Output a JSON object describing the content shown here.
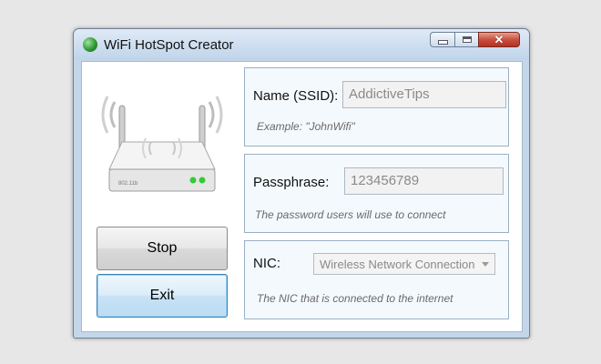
{
  "window": {
    "title": "WiFi HotSpot Creator",
    "controls": {
      "minimize": "minimize",
      "maximize": "maximize",
      "close": "✕"
    }
  },
  "router_image": {
    "label": "802.11b"
  },
  "buttons": {
    "stop": "Stop",
    "exit": "Exit"
  },
  "ssid": {
    "label": "Name (SSID):",
    "value": "AddictiveTips",
    "hint": "Example: \"JohnWifi\""
  },
  "passphrase": {
    "label": "Passphrase:",
    "value": "123456789",
    "hint": "The password users will use to connect"
  },
  "nic": {
    "label": "NIC:",
    "selected": "Wireless Network Connection",
    "hint": "The NIC that is connected to the internet"
  }
}
